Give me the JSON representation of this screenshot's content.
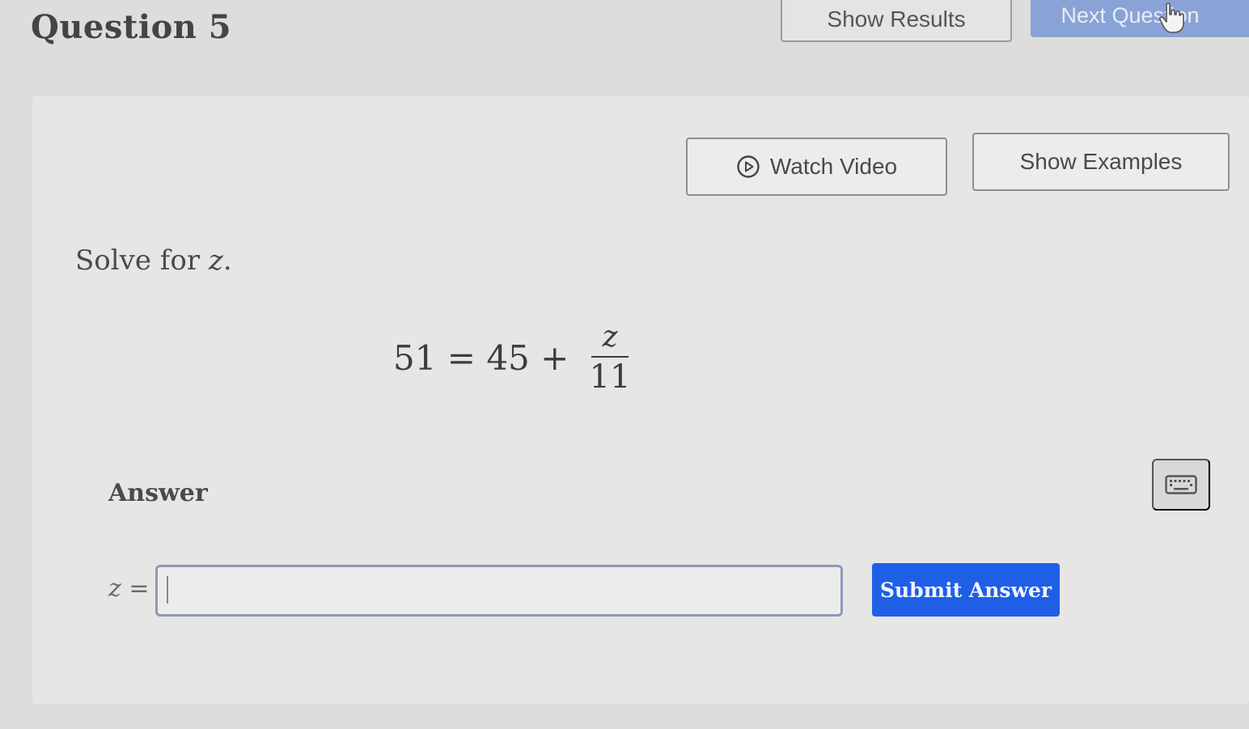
{
  "header": {
    "question_title": "Question 5",
    "show_results_label": "Show Results",
    "next_question_label": "Next Question"
  },
  "help": {
    "watch_video_label": "Watch Video",
    "show_examples_label": "Show Examples"
  },
  "problem": {
    "prompt_text": "Solve for ",
    "prompt_var": "z",
    "prompt_end": ".",
    "equation_left": "51 = 45 + ",
    "fraction_numerator": "z",
    "fraction_denominator": "11"
  },
  "answer": {
    "label": "Answer",
    "variable": "z",
    "equals": " =",
    "input_value": "",
    "submit_label": "Submit Answer"
  },
  "colors": {
    "submit": "#1f5fe6",
    "next_question": "#8aa3d6"
  },
  "icons": {
    "watch_video": "play-circle-icon",
    "keyboard": "keyboard-icon",
    "cursor": "hand-pointer-icon"
  }
}
